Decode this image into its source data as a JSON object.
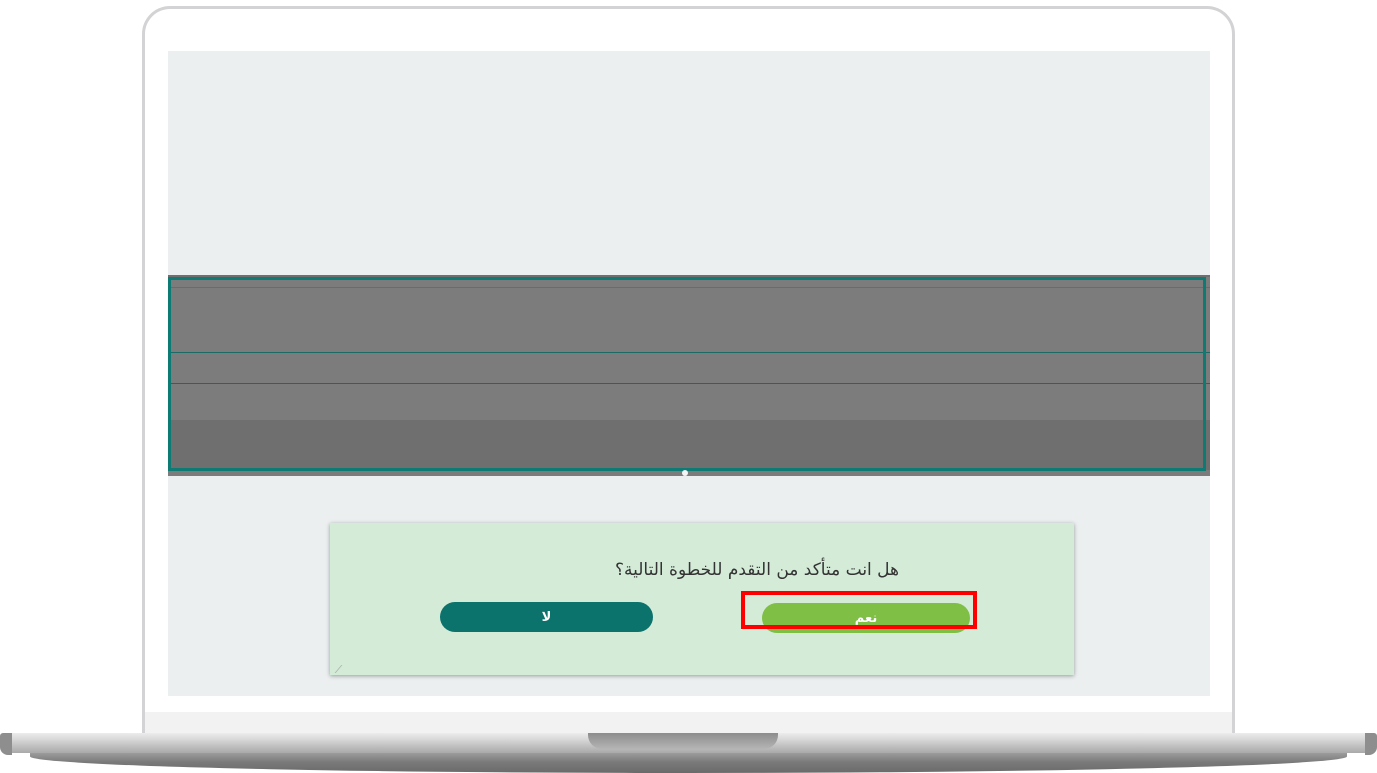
{
  "dialog": {
    "question": "هل انت متأكد من التقدم للخطوة التالية؟",
    "yes_label": "نعم",
    "no_label": "لا"
  },
  "colors": {
    "dialog_background": "#d4ebd8",
    "yes_button": "#80bf46",
    "no_button": "#0b726c",
    "highlight_box": "#ff0000",
    "strip_frame": "#0d7a74"
  }
}
